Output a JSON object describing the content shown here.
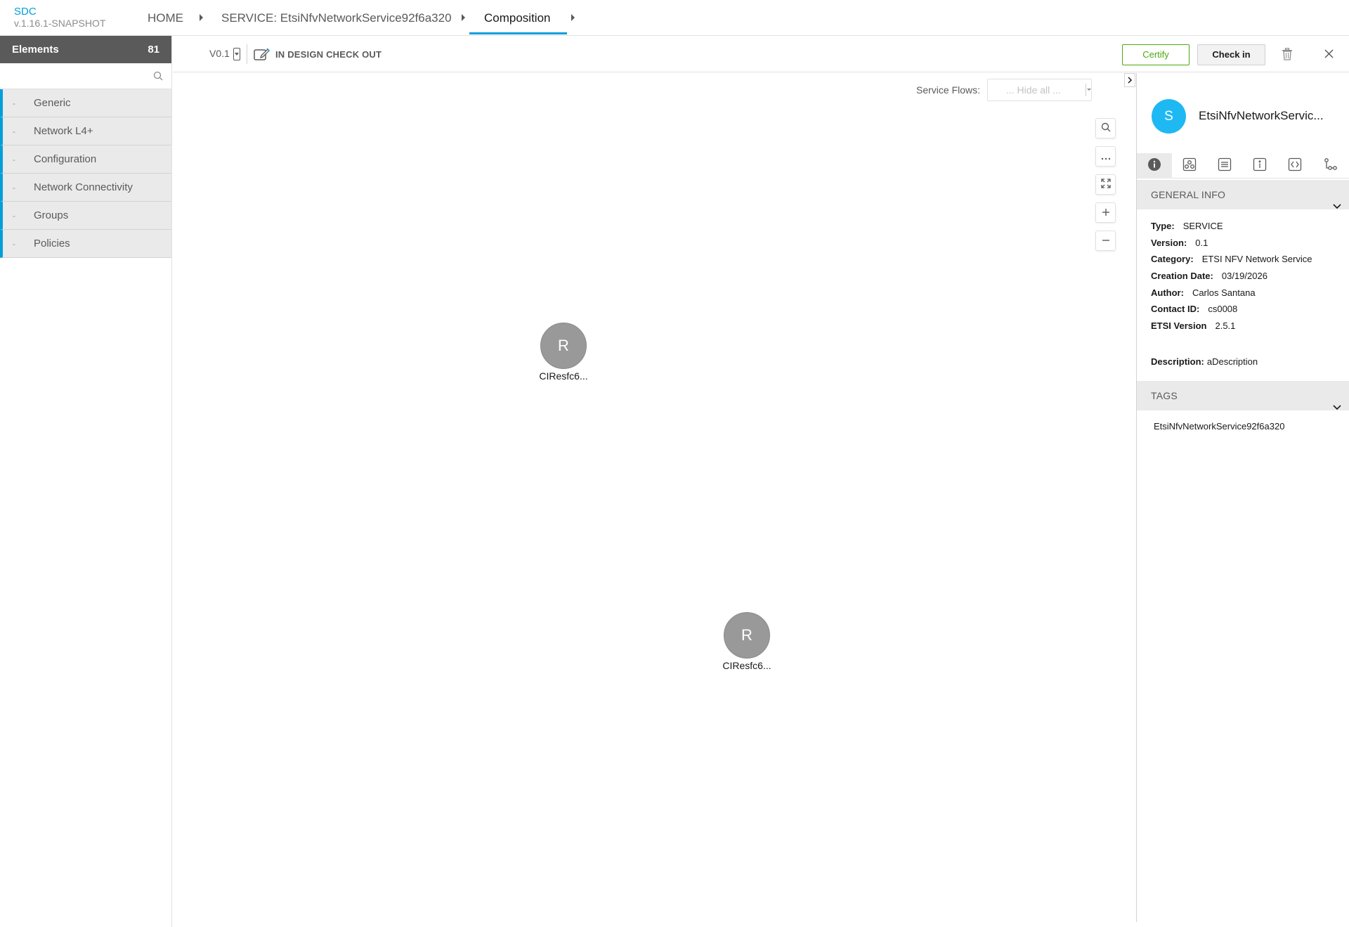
{
  "brand": {
    "name": "SDC",
    "version": "v.1.16.1-SNAPSHOT"
  },
  "breadcrumbs": [
    {
      "label": "HOME"
    },
    {
      "label": "SERVICE: EtsiNfvNetworkService92f6a320"
    },
    {
      "label": "Composition"
    }
  ],
  "palette": {
    "title": "Elements",
    "count": "81",
    "search_placeholder": "",
    "categories": [
      "Generic",
      "Network L4+",
      "Configuration",
      "Network Connectivity",
      "Groups",
      "Policies"
    ],
    "dash": "-"
  },
  "toolbar": {
    "version": "V0.1",
    "status": "IN DESIGN CHECK OUT",
    "certify_label": "Certify",
    "checkin_label": "Check in"
  },
  "canvas": {
    "flows_label": "Service Flows:",
    "flows_value": "... Hide all ...",
    "nodes": [
      {
        "initial": "R",
        "label": "CIResfc6..."
      },
      {
        "initial": "R",
        "label": "CIResfc6..."
      }
    ]
  },
  "panel": {
    "avatar_initial": "S",
    "title": "EtsiNfvNetworkServic...",
    "general_info_title": "GENERAL INFO",
    "info": [
      {
        "label": "Type:",
        "value": "SERVICE"
      },
      {
        "label": "Version:",
        "value": "0.1"
      },
      {
        "label": "Category:",
        "value": "ETSI NFV Network Service"
      },
      {
        "label": "Creation Date:",
        "value": "03/19/2026"
      },
      {
        "label": "Author:",
        "value": "Carlos Santana"
      },
      {
        "label": "Contact ID:",
        "value": "cs0008"
      },
      {
        "label": "ETSI Version",
        "value": "2.5.1"
      },
      {
        "label": "Description:",
        "value": "aDescription"
      }
    ],
    "tags_title": "TAGS",
    "tags": [
      "EtsiNfvNetworkService92f6a320"
    ]
  },
  "colors": {
    "accent": "#009fdb",
    "certify": "#4ca90c",
    "avatar": "#1eb9f3",
    "node": "#999999"
  }
}
